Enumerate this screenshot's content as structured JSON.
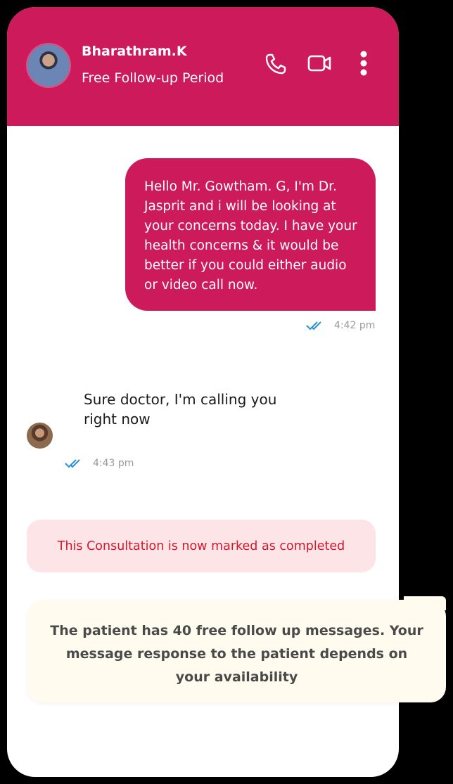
{
  "header": {
    "contact_name": "Bharathram.K",
    "status": "Free Follow-up Period",
    "bg_color": "#cd1a5b",
    "icons": [
      "phone-icon",
      "video-call-icon",
      "more-vertical-icon"
    ]
  },
  "messages": [
    {
      "direction": "outgoing",
      "text": "Hello Mr. Gowtham. G, I'm Dr. Jasprit and i will be looking at your concerns today. I have your health concerns & it would be better if you could either audio or video call now.",
      "time": "4:42 pm",
      "status_icon": "double-check-icon"
    },
    {
      "direction": "incoming",
      "text": "Sure doctor, I'm calling you right now",
      "time": "4:43 pm",
      "status_icon": "double-check-icon"
    }
  ],
  "notices": {
    "completed": "This Consultation is now marked as completed",
    "followup": "The patient has 40 free follow up messages. Your message response to the patient depends on your availability"
  },
  "colors": {
    "accent": "#cd1a5b",
    "tick": "#2a8fd6",
    "completed_text": "#d4182b",
    "completed_bg": "#fde4e7",
    "followup_bg": "#fffbee"
  }
}
